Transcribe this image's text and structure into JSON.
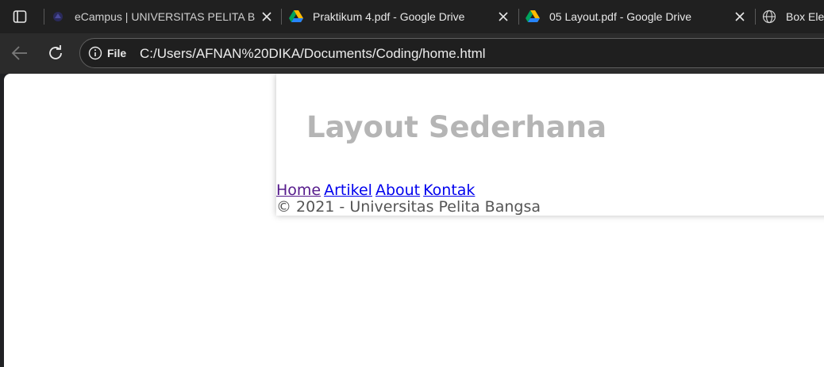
{
  "tabs": [
    {
      "title": "eCampus | UNIVERSITAS PELITA B",
      "favicon": "campus-favicon-icon"
    },
    {
      "title": "Praktikum 4.pdf - Google Drive",
      "favicon": "google-drive-icon"
    },
    {
      "title": "05 Layout.pdf - Google Drive",
      "favicon": "google-drive-icon"
    },
    {
      "title": "Box Ele",
      "favicon": "globe-icon"
    }
  ],
  "address_bar": {
    "scheme_label": "File",
    "url": "C:/Users/AFNAN%20DIKA/Documents/Coding/home.html"
  },
  "page": {
    "heading": "Layout Sederhana",
    "nav": [
      "Home",
      "Artikel",
      "About",
      "Kontak"
    ],
    "footer": "© 2021 - Universitas Pelita Bangsa"
  },
  "colors": {
    "tabstrip_bg": "#202020",
    "toolbar_bg": "#2b2b2b",
    "heading": "#b5b5b5",
    "link": "#0000ee",
    "visited_link": "#551a8b",
    "footer_text": "#555555"
  }
}
